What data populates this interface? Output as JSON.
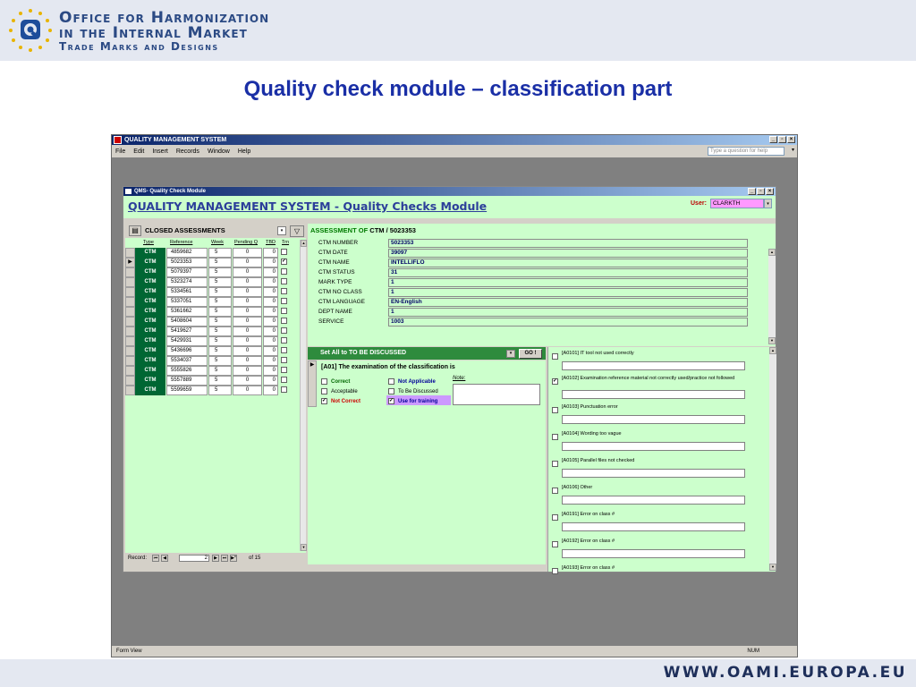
{
  "org": {
    "line1": "Office for Harmonization",
    "line2": "in the Internal Market",
    "line3": "Trade Marks and Designs"
  },
  "slide_title": "Quality check module – classification part",
  "footer_url": "WWW.OAMI.EUROPA.EU",
  "app": {
    "title": "QUALITY MANAGEMENT SYSTEM",
    "menus": [
      "File",
      "Edit",
      "Insert",
      "Records",
      "Window",
      "Help"
    ],
    "ask_placeholder": "Type a question for help",
    "status_left": "Form View",
    "status_right": "NUM"
  },
  "form": {
    "title": "QMS- Quality Check Module",
    "header_title": "QUALITY MANAGEMENT SYSTEM - Quality Checks Module",
    "user_label": "User:",
    "user_value": "CLARKTH"
  },
  "closed": {
    "title": "CLOSED ASSESSMENTS",
    "columns": [
      "Type",
      "Reference",
      "Week",
      "Pending Q",
      "TBD",
      "Trn"
    ],
    "rows": [
      {
        "type": "CTM",
        "ref": "4859682",
        "week": "5",
        "pq": "0",
        "tbd": "0",
        "trn": false,
        "current": false
      },
      {
        "type": "CTM",
        "ref": "5023353",
        "week": "5",
        "pq": "0",
        "tbd": "0",
        "trn": true,
        "current": true
      },
      {
        "type": "CTM",
        "ref": "5079397",
        "week": "5",
        "pq": "0",
        "tbd": "0",
        "trn": false,
        "current": false
      },
      {
        "type": "CTM",
        "ref": "5323274",
        "week": "5",
        "pq": "0",
        "tbd": "0",
        "trn": false,
        "current": false
      },
      {
        "type": "CTM",
        "ref": "5334561",
        "week": "5",
        "pq": "0",
        "tbd": "0",
        "trn": false,
        "current": false
      },
      {
        "type": "CTM",
        "ref": "5337051",
        "week": "5",
        "pq": "0",
        "tbd": "0",
        "trn": false,
        "current": false
      },
      {
        "type": "CTM",
        "ref": "5361662",
        "week": "5",
        "pq": "0",
        "tbd": "0",
        "trn": false,
        "current": false
      },
      {
        "type": "CTM",
        "ref": "5408604",
        "week": "5",
        "pq": "0",
        "tbd": "0",
        "trn": false,
        "current": false
      },
      {
        "type": "CTM",
        "ref": "5419627",
        "week": "5",
        "pq": "0",
        "tbd": "0",
        "trn": false,
        "current": false
      },
      {
        "type": "CTM",
        "ref": "5429931",
        "week": "5",
        "pq": "0",
        "tbd": "0",
        "trn": false,
        "current": false
      },
      {
        "type": "CTM",
        "ref": "5436696",
        "week": "5",
        "pq": "0",
        "tbd": "0",
        "trn": false,
        "current": false
      },
      {
        "type": "CTM",
        "ref": "5534037",
        "week": "5",
        "pq": "0",
        "tbd": "0",
        "trn": false,
        "current": false
      },
      {
        "type": "CTM",
        "ref": "5555826",
        "week": "5",
        "pq": "0",
        "tbd": "0",
        "trn": false,
        "current": false
      },
      {
        "type": "CTM",
        "ref": "5557889",
        "week": "5",
        "pq": "0",
        "tbd": "0",
        "trn": false,
        "current": false
      },
      {
        "type": "CTM",
        "ref": "5599659",
        "week": "5",
        "pq": "0",
        "tbd": "0",
        "trn": false,
        "current": false
      }
    ],
    "record_label": "Record:",
    "record_current": "2",
    "record_total": "of 15"
  },
  "assessment": {
    "title_prefix": "ASSESSMENT OF",
    "title_ref": "CTM / 5023353",
    "fields": [
      {
        "label": "CTM NUMBER",
        "value": "5023353"
      },
      {
        "label": "CTM DATE",
        "value": "39097"
      },
      {
        "label": "CTM NAME",
        "value": "INTELLIFLO"
      },
      {
        "label": "CTM STATUS",
        "value": "31"
      },
      {
        "label": "MARK TYPE",
        "value": "1"
      },
      {
        "label": "CTM NO CLASS",
        "value": "1"
      },
      {
        "label": "CTM LANGUAGE",
        "value": "EN-English"
      },
      {
        "label": "DEPT NAME",
        "value": "1"
      },
      {
        "label": "SERVICE",
        "value": "1003"
      }
    ]
  },
  "set_all": {
    "label": "Set All to TO BE DISCUSSED",
    "go": "GO !"
  },
  "question": {
    "label": "[A01] The examination of the classification is",
    "options": [
      {
        "label": "Correct",
        "checked": false,
        "color": "#006600"
      },
      {
        "label": "Not Applicable",
        "checked": false,
        "color": "#000099"
      },
      {
        "label": "Acceptable",
        "checked": false,
        "color": "#000000"
      },
      {
        "label": "To Be Discussed",
        "checked": false,
        "color": "#000000"
      },
      {
        "label": "Not Correct",
        "checked": true,
        "color": "#cc0000"
      },
      {
        "label": "Use for training",
        "checked": true,
        "color": "#000099"
      }
    ],
    "note_label": "Note:"
  },
  "errors": [
    {
      "label": "[A0101] IT tool not used correctly",
      "checked": false
    },
    {
      "label": "[A0102] Examination reference material not correctly used/practice not followed",
      "checked": true
    },
    {
      "label": "[A0103] Punctuation error",
      "checked": false
    },
    {
      "label": "[A0104] Wording too vague",
      "checked": false
    },
    {
      "label": "[A0105] Parallel files not checked",
      "checked": false
    },
    {
      "label": "[A0106] Other",
      "checked": false
    },
    {
      "label": "[A0191] Error on class #",
      "checked": false
    },
    {
      "label": "[A0192] Error on class #",
      "checked": false
    },
    {
      "label": "[A0193] Error on class #",
      "checked": false
    }
  ]
}
